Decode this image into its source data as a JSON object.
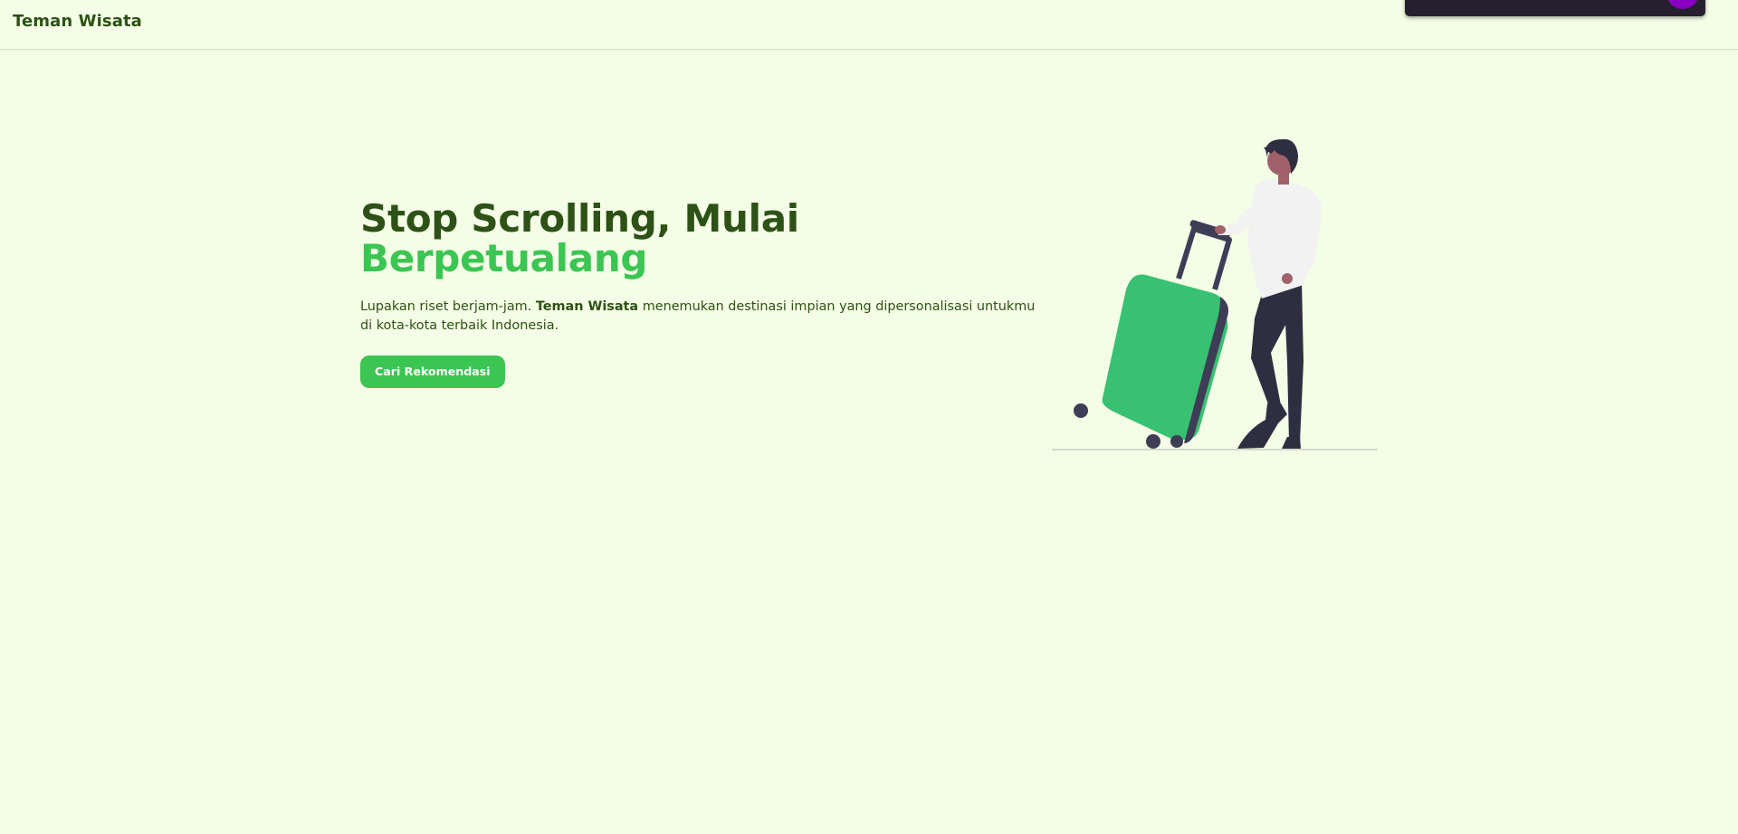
{
  "navbar": {
    "brand": "Teman Wisata"
  },
  "hero": {
    "title_line1": "Stop Scrolling, Mulai",
    "title_line2": "Berpetualang",
    "description_before": "Lupakan riset berjam-jam. ",
    "description_bold": "Teman Wisata",
    "description_after": " menemukan destinasi impian yang dipersonalisasi untukmu di kota-kota terbaik Indonesia.",
    "cta_label": "Cari Rekomendasi",
    "illustration": "traveler-with-suitcase"
  },
  "colors": {
    "background": "#F4FDE5",
    "primary_dark": "#2D5116",
    "accent_green": "#3BC552",
    "suitcase_green": "#38C172",
    "dark": "#2F2E41"
  }
}
